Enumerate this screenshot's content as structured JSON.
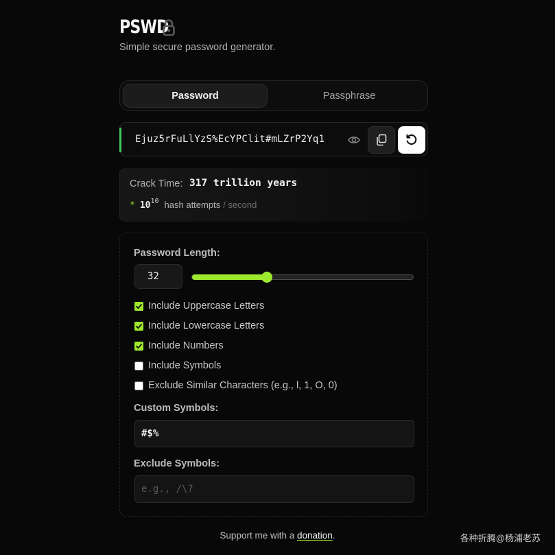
{
  "app": {
    "title": "PSWD",
    "subtitle": "Simple secure password generator."
  },
  "tabs": [
    {
      "label": "Password",
      "active": true
    },
    {
      "label": "Passphrase",
      "active": false
    }
  ],
  "password": {
    "value": "Ejuz5rFuLlYzS%EcYPClit#mLZrP2Yq1",
    "strength_color": "#3ecb5c"
  },
  "crack": {
    "label": "Crack Time:",
    "value": "317 trillion years",
    "marker": "*",
    "hash_base": "10",
    "hash_exp": "10",
    "hash_text": "hash attempts",
    "per_text": "/ second"
  },
  "settings": {
    "length_label": "Password Length:",
    "length_value": "32",
    "length_fraction": 0.34,
    "options": [
      {
        "label": "Include Uppercase Letters",
        "checked": true
      },
      {
        "label": "Include Lowercase Letters",
        "checked": true
      },
      {
        "label": "Include Numbers",
        "checked": true
      },
      {
        "label": "Include Symbols",
        "checked": false
      },
      {
        "label": "Exclude Similar Characters (e.g., l, 1, O, 0)",
        "checked": false
      }
    ],
    "custom_label": "Custom Symbols:",
    "custom_value": "#$%",
    "exclude_label": "Exclude Symbols:",
    "exclude_placeholder": "e.g., /\\?"
  },
  "footer": {
    "prefix": "Support me with a ",
    "link": "donation",
    "suffix": "."
  },
  "watermark": "各种折腾@杨浦老苏",
  "colors": {
    "accent": "#9ee82e",
    "background": "#080808"
  },
  "icons": [
    "lock-icon",
    "eye-icon",
    "copy-icon",
    "refresh-icon",
    "check-icon"
  ]
}
